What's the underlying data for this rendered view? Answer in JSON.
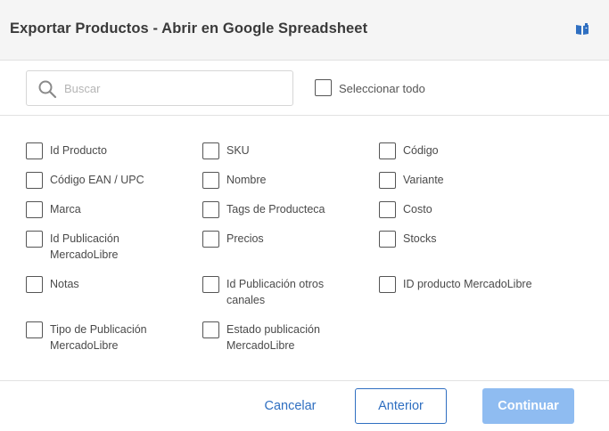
{
  "header": {
    "title": "Exportar Productos - Abrir en Google Spreadsheet",
    "help_icon": "book-icon"
  },
  "search": {
    "placeholder": "Buscar",
    "value": ""
  },
  "select_all": {
    "label": "Seleccionar todo",
    "checked": false
  },
  "fields": [
    {
      "label": "Id Producto",
      "checked": false
    },
    {
      "label": "SKU",
      "checked": false
    },
    {
      "label": "Código",
      "checked": false
    },
    {
      "label": "Código EAN / UPC",
      "checked": false
    },
    {
      "label": "Nombre",
      "checked": false
    },
    {
      "label": "Variante",
      "checked": false
    },
    {
      "label": "Marca",
      "checked": false
    },
    {
      "label": "Tags de Producteca",
      "checked": false
    },
    {
      "label": "Costo",
      "checked": false
    },
    {
      "label": "Id Publicación MercadoLibre",
      "checked": false
    },
    {
      "label": "Precios",
      "checked": false
    },
    {
      "label": "Stocks",
      "checked": false
    },
    {
      "label": "Notas",
      "checked": false
    },
    {
      "label": "Id Publicación otros canales",
      "checked": false
    },
    {
      "label": "ID producto MercadoLibre",
      "checked": false
    },
    {
      "label": "Tipo de Publicación MercadoLibre",
      "checked": false
    },
    {
      "label": "Estado publicación MercadoLibre",
      "checked": false
    }
  ],
  "footer": {
    "cancel_label": "Cancelar",
    "previous_label": "Anterior",
    "continue_label": "Continuar",
    "continue_enabled": false
  },
  "colors": {
    "accent": "#2f6fc1",
    "disabled_primary": "#8fbcf1",
    "header_bg": "#f5f5f5"
  }
}
